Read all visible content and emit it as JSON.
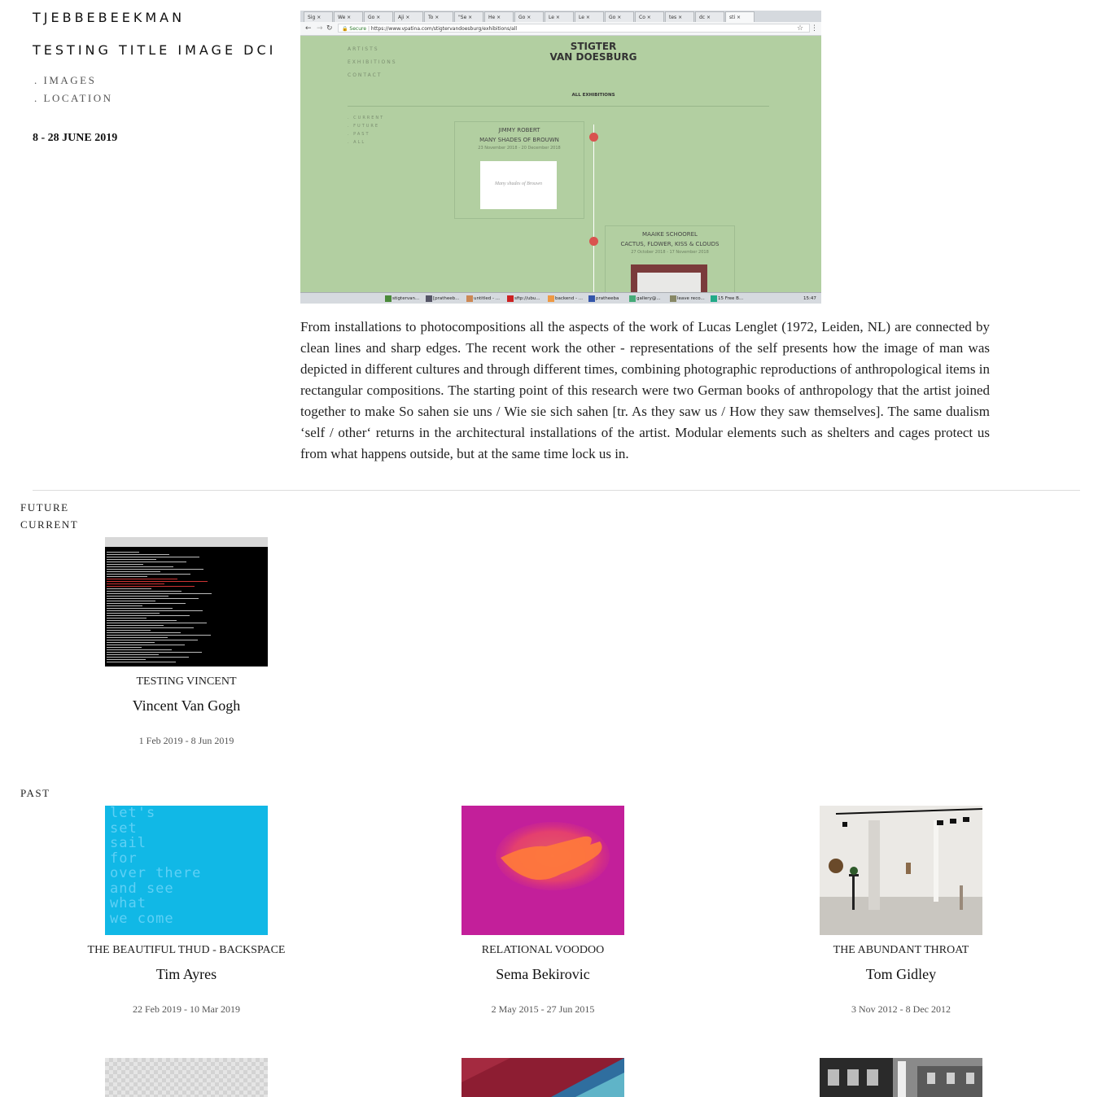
{
  "site": {
    "name": "TJEBBEBEEKMAN"
  },
  "exhibition": {
    "title": "TESTING TITLE IMAGE DCI",
    "nav": [
      ". IMAGES",
      ". LOCATION"
    ],
    "dates": "8 - 28 JUNE 2019",
    "description": "From installations to photocompositions all the aspects of the work of Lucas Lenglet (1972, Leiden, NL) are connected by clean lines and sharp edges. The recent work the other - representations of the self presents how the image of man was depicted in different cultures and through different times, combining photographic reproductions of anthropological items in rectangular compositions. The starting point of this research were two German books of anthropology that the artist joined together to make So sahen sie uns / Wie sie sich sahen [tr. As they saw us / How they saw themselves]. The same dualism ‘self / other‘ returns in the architectural installations of the artist. Modular elements such as shelters and cages protect us from what happens outside, but at the same time lock us in."
  },
  "screenshot": {
    "tabs": [
      "Sig",
      "We",
      "Go",
      "Aji",
      "To",
      "\"Se",
      "He",
      "Go",
      "Le",
      "Le",
      "Go",
      "Co",
      "tes",
      "dc",
      "sti"
    ],
    "secure": "Secure",
    "url": "https://www.vpatina.com/stigtervandoesburg/exhibitions/all",
    "site_nav": [
      "ARTISTS",
      "EXHIBITIONS",
      "CONTACT"
    ],
    "brand_line1": "STIGTER",
    "brand_line2": "VAN DOESBURG",
    "all_exhibitions": "ALL EXHIBITIONS",
    "sub_nav": [
      ". CURRENT",
      ". FUTURE",
      ". PAST",
      ". ALL"
    ],
    "card1": {
      "artist": "JIMMY ROBERT",
      "title": "MANY SHADES OF BROUWN",
      "dates": "23 November 2018 - 20 December 2018",
      "thumb_text": "Many shades of Brouwn"
    },
    "card2": {
      "artist": "MAAIKE SCHOOREL",
      "title": "CACTUS, FLOWER, KISS & CLOUDS",
      "dates": "27 October 2018 - 17 November 2018"
    },
    "taskbar": [
      "stigtervan...",
      "[pratheeb...",
      "untitled - ...",
      "sftp://ubu...",
      "backend - ...",
      "pratheeba",
      "gallery@...",
      "leave reco...",
      "15 Free B..."
    ],
    "clock": "15:47"
  },
  "sections": {
    "future_label": "FUTURE",
    "current_label": "CURRENT",
    "past_label": "PAST"
  },
  "current": [
    {
      "title": "TESTING VINCENT",
      "artist": "Vincent Van Gogh",
      "dates": "1 Feb 2019 - 8 Jun 2019",
      "image_icon": "terminal-screenshot"
    }
  ],
  "past": [
    {
      "title": "THE BEAUTIFUL THUD - BACKSPACE",
      "artist": "Tim Ayres",
      "dates": "22 Feb 2019 - 10 Mar 2019",
      "image_text": [
        "let's",
        "set",
        "sail",
        "for",
        "over there",
        "and see",
        "what",
        "we come"
      ]
    },
    {
      "title": "RELATIONAL VOODOO",
      "artist": "Sema Bekirovic",
      "dates": "2 May 2015 - 27 Jun 2015",
      "image_icon": "glowing-hand"
    },
    {
      "title": "THE ABUNDANT THROAT",
      "artist": "Tom Gidley",
      "dates": "3 Nov 2012 - 8 Dec 2012",
      "image_icon": "gallery-room"
    }
  ],
  "colors": {
    "screenshot_bg": "#b2cfa1",
    "timeline_dot": "#d9534f",
    "sail_bg": "#11b8e6",
    "voodoo_bg": "#c31f9a"
  }
}
